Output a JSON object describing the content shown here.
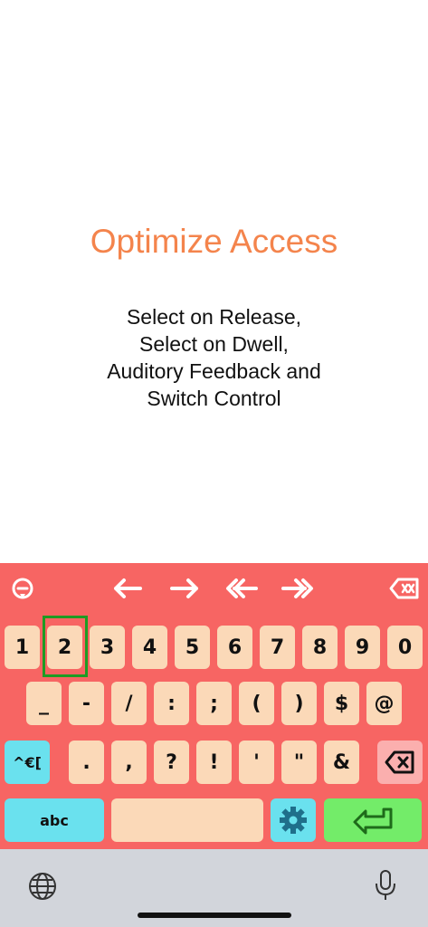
{
  "content": {
    "title": "Optimize Access",
    "subtitle_lines": [
      "Select on Release,",
      "Select on Dwell,",
      "Auditory Feedback and",
      "Switch Control"
    ]
  },
  "keyboard": {
    "background_color": "#F76563",
    "key_color": "#FBD9B8",
    "accent_colors": {
      "mode_key": "#6AE1EE",
      "enter_key": "#73EC69",
      "delete_key": "#FBAFAE",
      "focus_ring": "#1E9B23"
    },
    "toolbar": [
      "emoji-face-icon",
      "arrow-left-icon",
      "arrow-right-icon",
      "double-arrow-left-icon",
      "double-arrow-right-icon",
      "delete-word-icon"
    ],
    "row1": [
      "1",
      "2",
      "3",
      "4",
      "5",
      "6",
      "7",
      "8",
      "9",
      "0"
    ],
    "row2": [
      "_",
      "-",
      "/",
      ":",
      ";",
      "(",
      ")",
      "$",
      "@"
    ],
    "row3": [
      ".",
      ",",
      "?",
      "!",
      "'",
      "\"",
      "&"
    ],
    "mode_key": "^€[",
    "abc_key": "abc",
    "highlighted_key": "2"
  },
  "system_bar": {
    "left_icon": "globe-icon",
    "right_icon": "microphone-icon"
  }
}
